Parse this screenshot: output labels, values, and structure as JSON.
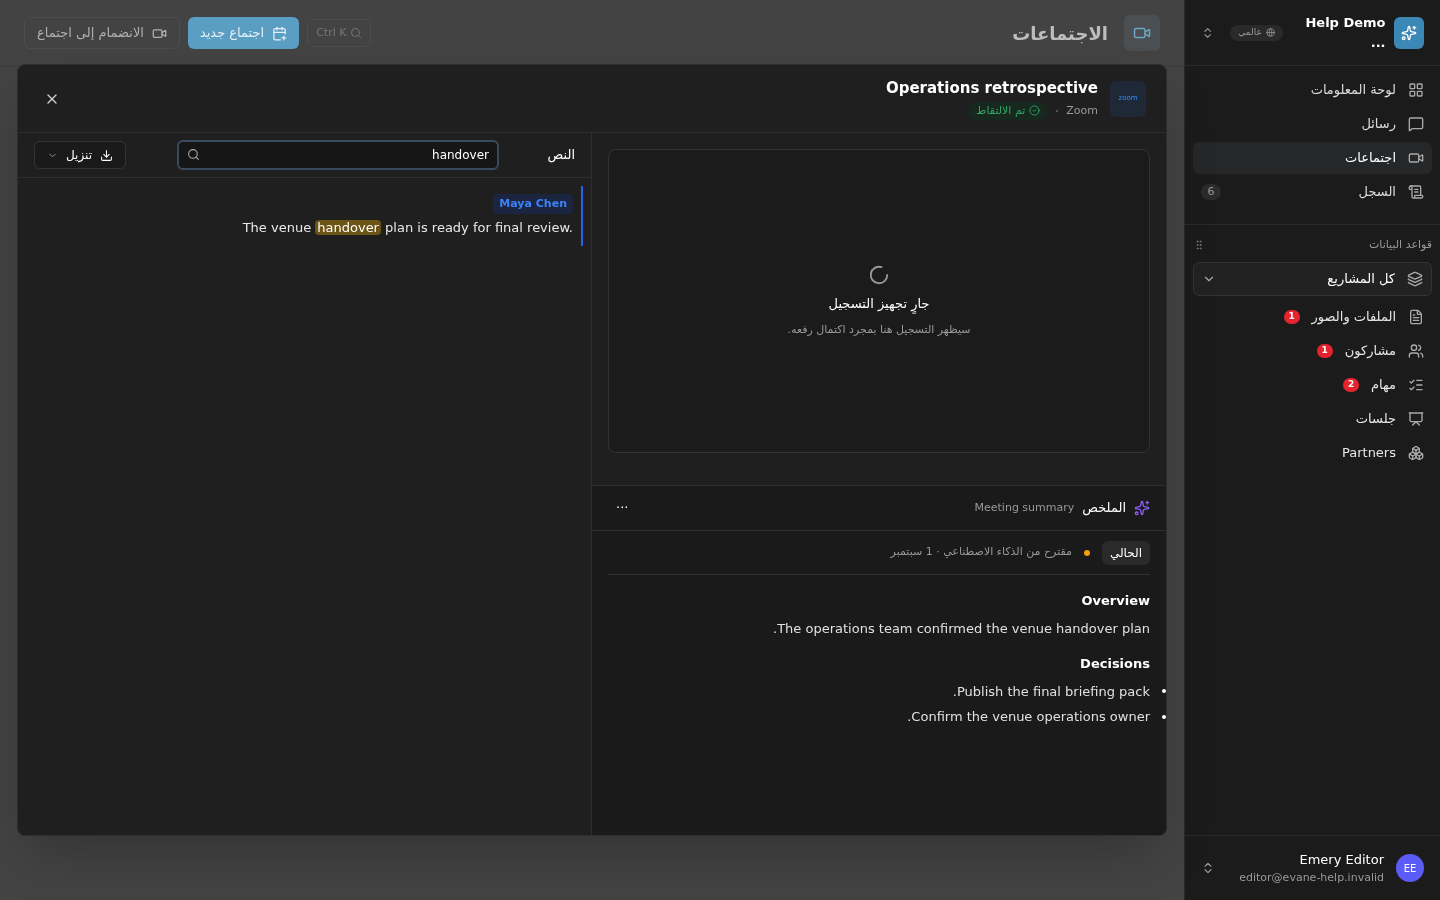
{
  "sidebar": {
    "workspace": {
      "name": "Help Demo ...",
      "scope": "عالمي"
    },
    "nav": [
      {
        "label": "لوحة المعلومات",
        "selected": false
      },
      {
        "label": "رسائل",
        "selected": false
      },
      {
        "label": "اجتماعات",
        "selected": true
      },
      {
        "label": "السجل",
        "selected": false,
        "badge": {
          "text": "6",
          "kind": "muted"
        }
      }
    ],
    "section_title": "قواعد البيانات",
    "project_select": {
      "value": "كل المشاريع"
    },
    "databases": [
      {
        "label": "الملفات والصور",
        "badge": {
          "text": "1",
          "kind": "alert"
        }
      },
      {
        "label": "مشاركون",
        "badge": {
          "text": "1",
          "kind": "alert"
        }
      },
      {
        "label": "مهام",
        "badge": {
          "text": "2",
          "kind": "alert"
        }
      },
      {
        "label": "جلسات"
      },
      {
        "label": "Partners"
      }
    ],
    "user": {
      "name": "Emery Editor",
      "email": "editor@evane-help.invalid",
      "initials": "EE"
    }
  },
  "page": {
    "title": "الاجتماعات",
    "search_shortcut": "Ctrl K",
    "new_button": "اجتماع جديد",
    "join_button": "الانضمام إلى اجتماع"
  },
  "dialog": {
    "logo": "zoom",
    "title": "Operations retrospective",
    "provider": "Zoom",
    "status": "تم الالتقاط",
    "recording": {
      "title": "جارٍ تجهيز التسجيل",
      "message": "سيظهر التسجيل هنا بمجرد اكتمال رفعه."
    },
    "summary": {
      "title": "الملخص",
      "subtitle": "Meeting summary",
      "more": "···",
      "version": "الحالي",
      "source": "مقترح من الذكاء الاصطناعي · 1 سبتمبر",
      "sections": [
        {
          "heading": "Overview",
          "kind": "paragraph",
          "text": "The operations team confirmed the venue handover plan."
        },
        {
          "heading": "Decisions",
          "kind": "list",
          "items": [
            "Publish the final briefing pack.",
            "Confirm the venue operations owner."
          ]
        }
      ]
    },
    "transcript": {
      "label": "النص",
      "search": {
        "value": "handover"
      },
      "download": "تنزيل",
      "entries": [
        {
          "speaker": "Maya Chen",
          "selected": true,
          "text_before": "The venue ",
          "highlighted": "handover",
          "text_after": " plan is ready for final review."
        }
      ]
    }
  }
}
